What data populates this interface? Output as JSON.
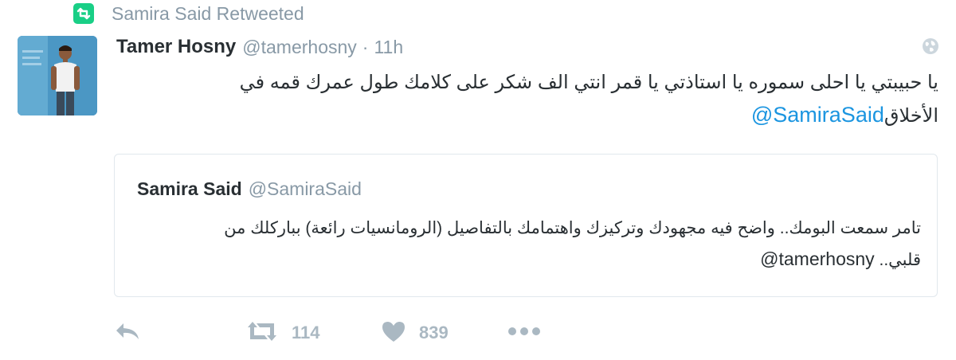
{
  "retweet_context": {
    "icon": "retweet-icon",
    "text": "Samira Said Retweeted"
  },
  "tweet": {
    "author_name": "Tamer Hosny",
    "author_handle": "@tamerhosny",
    "separator": "·",
    "timestamp": "11h",
    "text_line1": "يا حبيبتي يا احلى سموره يا استاذتي يا قمر انتي الف شكر على كلامك طول عمرك قمه في",
    "text_line2_prefix": "الأخلاق",
    "text_mention": "@SamiraSaid"
  },
  "quoted_tweet": {
    "author_name": "Samira Said",
    "author_handle": "@SamiraSaid",
    "text_line1": "تامر سمعت البومك.. واضح فيه مجهودك وتركيزك واهتمامك بالتفاصيل (الرومانسيات رائعة) بباركلك من",
    "text_line2_prefix": "قلبي..",
    "text_mention": "@tamerhosny"
  },
  "actions": {
    "retweet_count": "114",
    "like_count": "839"
  },
  "colors": {
    "retweet_green": "#19cf86",
    "link_blue": "#1b95e0",
    "muted_gray": "#8899a6",
    "action_gray": "#aab8c2"
  }
}
